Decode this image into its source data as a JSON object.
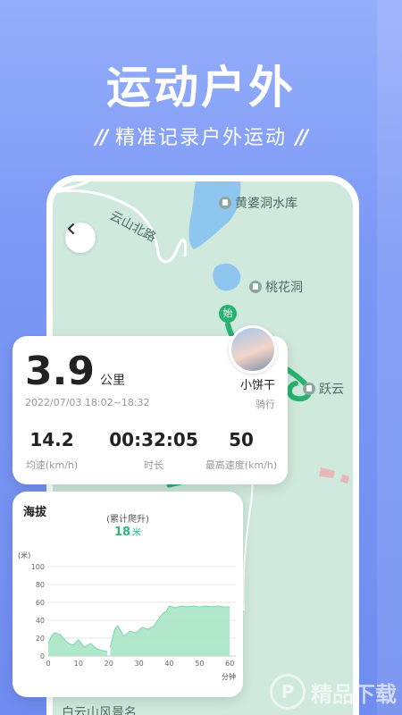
{
  "headline": "运动户外",
  "subline": "精准记录户外运动",
  "map": {
    "labels": {
      "road": "云山北路",
      "reservoir": "黄婆洞水库",
      "peach_cave": "桃花洞",
      "yueyun": "跃云",
      "baiyun_scenic": "白云山风景名"
    },
    "start_marker": "始"
  },
  "stats": {
    "distance": "3.9",
    "distance_unit": "公里",
    "date": "2022/07/03 18:02~18:32",
    "username": "小饼干",
    "activity": "骑行",
    "metrics": [
      {
        "value": "14.2",
        "label": "均速(km/h)"
      },
      {
        "value": "00:32:05",
        "label": "时长"
      },
      {
        "value": "50",
        "label": "最高速度(km/h)"
      }
    ]
  },
  "elevation": {
    "title": "海拔",
    "climb_label": "(累计爬升)",
    "climb_value": "18",
    "climb_unit": "米"
  },
  "chart_data": {
    "type": "area",
    "title": "海拔",
    "ylabel": "(米)",
    "xlabel": "分钟",
    "x_ticks": [
      0,
      10,
      20,
      30,
      40,
      50,
      60
    ],
    "y_ticks": [
      0,
      20,
      40,
      60,
      80,
      100
    ],
    "ylim": [
      0,
      100
    ],
    "xlim": [
      0,
      62
    ],
    "x_tick_labels": [
      "0",
      "10",
      "20",
      "30",
      "40",
      "50",
      "60"
    ],
    "y_tick_labels": [
      "0",
      "20",
      "40",
      "60",
      "80",
      "100"
    ],
    "segments": [
      {
        "x": [
          0,
          1,
          2,
          4,
          6,
          8,
          10,
          12,
          14,
          16,
          18,
          19.5
        ],
        "y": [
          14,
          22,
          26,
          24,
          16,
          12,
          18,
          10,
          14,
          8,
          6,
          5
        ]
      },
      {
        "x": [
          20.5,
          22,
          23,
          25,
          27,
          29,
          31,
          33,
          35,
          37,
          38,
          39,
          40,
          42,
          44,
          46,
          48,
          50,
          52,
          54,
          56,
          58,
          60
        ],
        "y": [
          10,
          30,
          34,
          22,
          28,
          26,
          32,
          30,
          34,
          44,
          48,
          50,
          56,
          54,
          56,
          55,
          56,
          55,
          56,
          55,
          56,
          55,
          55
        ]
      }
    ],
    "color": "#a8e6c7",
    "grid": true
  },
  "colors": {
    "route": "#27b36f",
    "accent_green": "#2fb579"
  },
  "watermark": {
    "text": "精品下载",
    "logo": "P"
  }
}
